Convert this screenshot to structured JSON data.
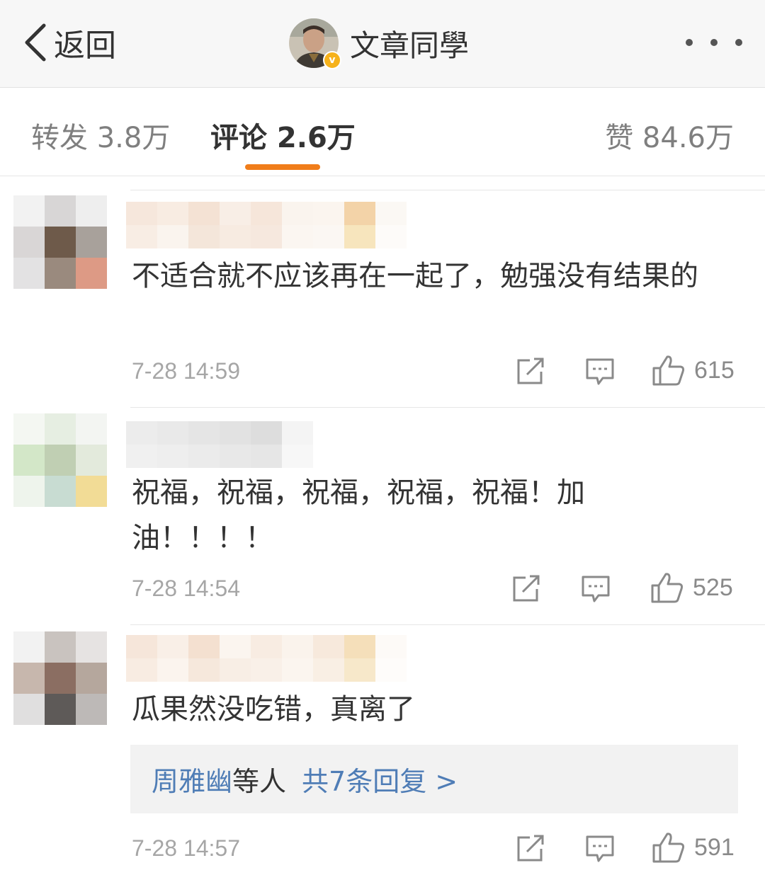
{
  "nav": {
    "back_label": "返回",
    "title": "文章同學",
    "verified_mark": "v",
    "more_icon": "more-dots-icon"
  },
  "tabs": [
    {
      "label": "转发 3.8万",
      "active": false
    },
    {
      "label": "评论 2.6万",
      "active": true
    },
    {
      "label": "赞 84.6万",
      "active": false
    }
  ],
  "accent_color": "#f07d1a",
  "link_color": "#4f7db6",
  "comments": [
    {
      "text": "不适合就不应该再在一起了，勉强没有结果的",
      "time": "7-28 14:59",
      "likes": "615"
    },
    {
      "text": "祝福，祝福，祝福，祝福，祝福！加油！！！！",
      "time": "7-28 14:54",
      "likes": "525"
    },
    {
      "text": "瓜果然没吃错，真离了",
      "time": "7-28 14:57",
      "likes": "591",
      "replies": {
        "user": "周雅幽",
        "suffix": "等人",
        "count_label": "共7条回复 >"
      }
    }
  ],
  "icons": {
    "back": "chevron-left-icon",
    "repost": "repost-icon",
    "comment": "comment-icon",
    "like": "thumbs-up-icon"
  }
}
